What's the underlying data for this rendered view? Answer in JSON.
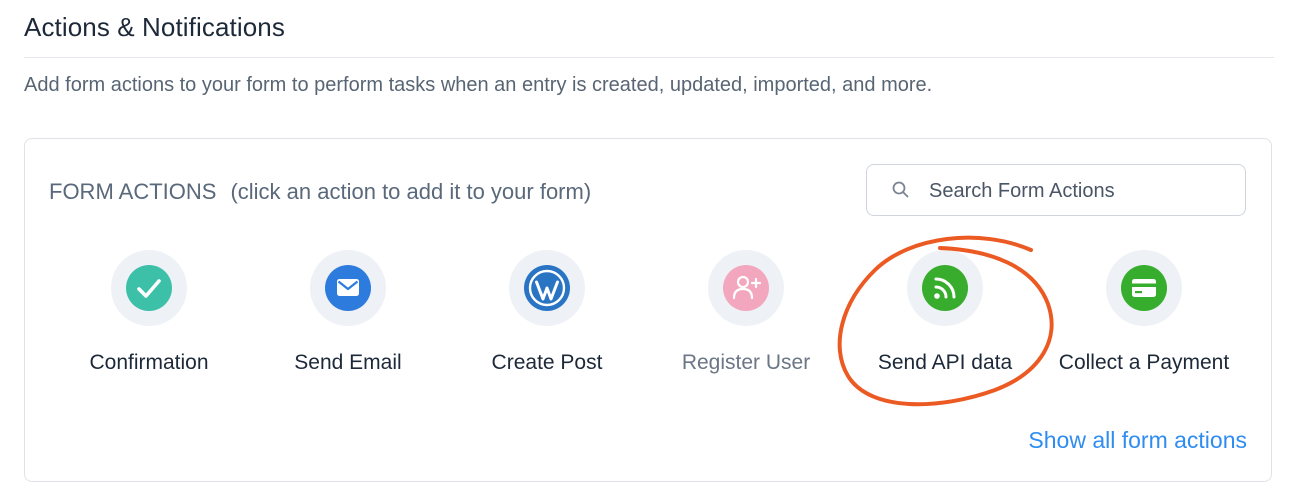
{
  "section": {
    "title": "Actions & Notifications",
    "description": "Add form actions to your form to perform tasks when an entry is created, updated, imported, and more."
  },
  "panel": {
    "heading": "FORM ACTIONS",
    "hint": "(click an action to add it to your form)",
    "search": {
      "placeholder": "Search Form Actions",
      "value": ""
    },
    "actions": [
      {
        "label": "Confirmation",
        "icon": "checkmark-icon",
        "color": "#3cc0a8",
        "enabled": true
      },
      {
        "label": "Send Email",
        "icon": "envelope-icon",
        "color": "#2d7bdc",
        "enabled": true
      },
      {
        "label": "Create Post",
        "icon": "wordpress-icon",
        "color": "#2a74c4",
        "enabled": true
      },
      {
        "label": "Register User",
        "icon": "add-user-icon",
        "color": "#f3a7be",
        "enabled": false
      },
      {
        "label": "Send API data",
        "icon": "rss-icon",
        "color": "#38ad2d",
        "enabled": true
      },
      {
        "label": "Collect a Payment",
        "icon": "credit-card-icon",
        "color": "#36ad2d",
        "enabled": true
      }
    ],
    "show_all_link": "Show all form actions"
  },
  "annotation": {
    "color": "#ec5a24",
    "target": "Send API data"
  },
  "colors": {
    "link": "#2f8cf0",
    "border": "#dfe3e8",
    "icon_background": "#eef1f5"
  }
}
